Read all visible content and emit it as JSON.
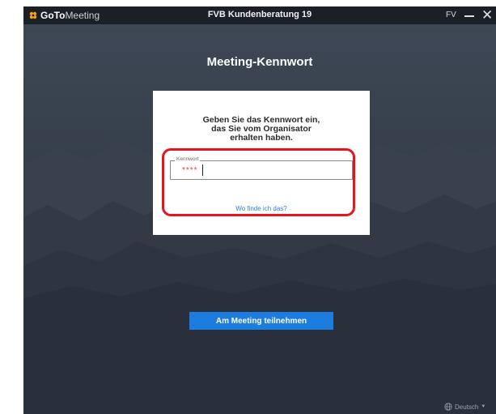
{
  "titlebar": {
    "brand_goto": "GoTo",
    "brand_meeting": "Meeting",
    "title": "FVB Kundenberatung 19",
    "user_initials": "FV",
    "minimize_icon": "minimize-icon",
    "close_label": "✕"
  },
  "dialog": {
    "title": "Meeting-Kennwort",
    "prompt_lines": [
      "Geben Sie das Kennwort ein,",
      "das Sie vom Organisator",
      "erhalten haben."
    ],
    "password_legend": "Kennwort",
    "password_value": "****",
    "help_link": "Wo finde ich das?"
  },
  "actions": {
    "join_label": "Am Meeting teilnehmen"
  },
  "footer": {
    "language": "Deutsch"
  },
  "colors": {
    "accent": "#1c7ce0",
    "highlight": "#e8141c",
    "brand_orange": "#f6a21c",
    "titlebar_bg": "#1b1f26"
  }
}
